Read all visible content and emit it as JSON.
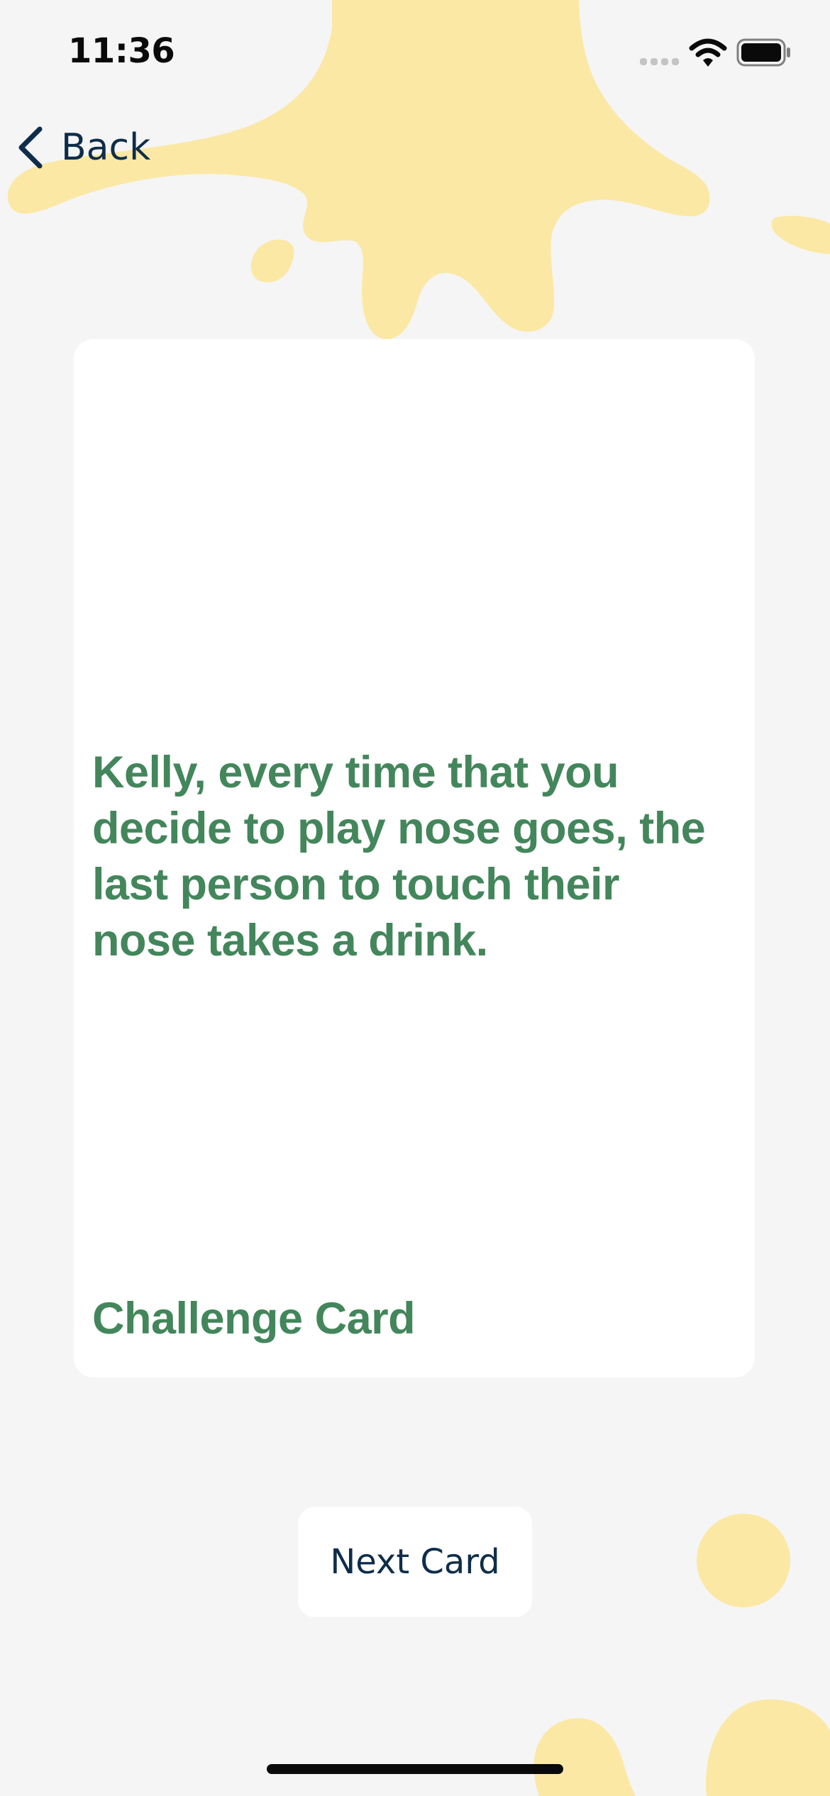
{
  "status_bar": {
    "time": "11:36",
    "icons": [
      "cellular-signal-icon",
      "wifi-icon",
      "battery-icon"
    ]
  },
  "nav": {
    "back_label": "Back",
    "back_icon": "chevron-left-icon"
  },
  "card": {
    "text": "Kelly, every time that you decide to play nose goes, the last person to touch their nose takes a drink.",
    "type_label": "Challenge Card"
  },
  "next_button": {
    "label": "Next Card"
  },
  "colors": {
    "background": "#f5f5f5",
    "splash": "#fbe8a4",
    "card_text": "#43865b",
    "nav_text": "#0f2d4a"
  }
}
